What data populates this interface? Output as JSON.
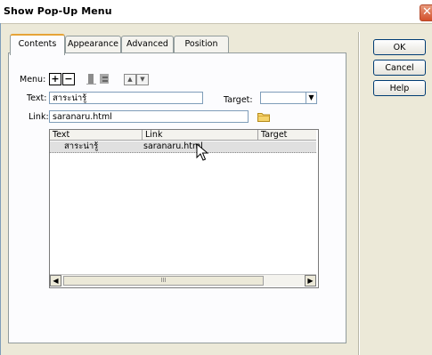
{
  "window": {
    "title": "Show Pop-Up Menu",
    "close": "✕"
  },
  "tabs": [
    {
      "label": "Contents"
    },
    {
      "label": "Appearance"
    },
    {
      "label": "Advanced"
    },
    {
      "label": "Position"
    }
  ],
  "contents": {
    "menu_label": "Menu:",
    "add_symbol": "+",
    "remove_symbol": "−",
    "text_label": "Text:",
    "text_value": "สาระน่ารู้",
    "target_label": "Target:",
    "target_value": "",
    "link_label": "Link:",
    "link_value": "saranaru.html"
  },
  "grid": {
    "columns": [
      "Text",
      "Link",
      "Target"
    ],
    "rows": [
      {
        "text": "สาระน่ารู้",
        "link": "saranaru.html",
        "target": ""
      }
    ],
    "scroll_thumb_grip": "III"
  },
  "buttons": {
    "ok": "OK",
    "cancel": "Cancel",
    "help": "Help"
  },
  "icons": {
    "add": "add-item-icon",
    "remove": "remove-item-icon",
    "indent": "indent-item-icon",
    "outdent": "outdent-item-icon",
    "move_up": "move-up-icon",
    "move_down": "move-down-icon",
    "browse": "folder-icon"
  }
}
